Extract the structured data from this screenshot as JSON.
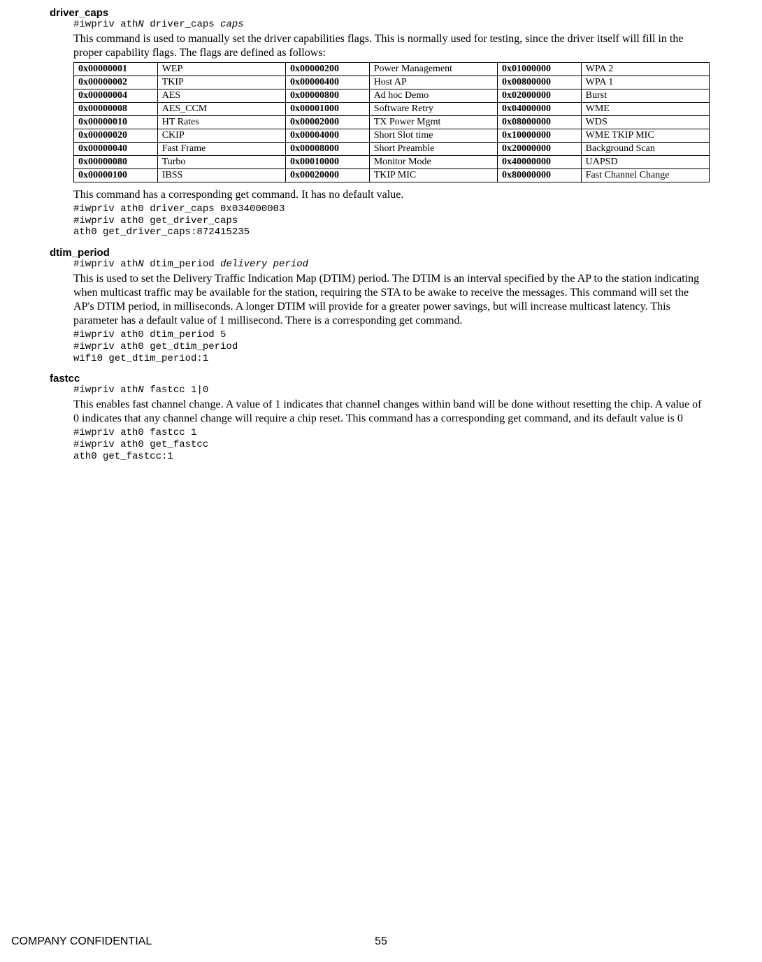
{
  "footer": {
    "label": "COMPANY CONFIDENTIAL",
    "page": "55"
  },
  "driver_caps": {
    "title": "driver_caps",
    "syntax_pre": "#iwpriv ath",
    "syntax_n": "N",
    "syntax_mid": " driver_caps ",
    "syntax_arg": "caps",
    "desc1": "This command is used to manually set the driver capabilities flags. This is normally used for testing, since the driver itself will fill in the proper capability flags. The flags are defined as follows:",
    "table": [
      [
        "0x00000001",
        "WEP",
        "0x00000200",
        "Power Management",
        "0x01000000",
        "WPA 2"
      ],
      [
        "0x00000002",
        "TKIP",
        "0x00000400",
        "Host AP",
        "0x00800000",
        "WPA 1"
      ],
      [
        "0x00000004",
        "AES",
        "0x00000800",
        "Ad hoc Demo",
        "0x02000000",
        "Burst"
      ],
      [
        "0x00000008",
        "AES_CCM",
        "0x00001000",
        "Software Retry",
        "0x04000000",
        "WME"
      ],
      [
        "0x00000010",
        "HT Rates",
        "0x00002000",
        "TX Power Mgmt",
        "0x08000000",
        "WDS"
      ],
      [
        "0x00000020",
        "CKIP",
        "0x00004000",
        "Short Slot time",
        "0x10000000",
        "WME TKIP MIC"
      ],
      [
        "0x00000040",
        "Fast Frame",
        "0x00008000",
        "Short Preamble",
        "0x20000000",
        "Background Scan"
      ],
      [
        "0x00000080",
        "Turbo",
        "0x00010000",
        "Monitor Mode",
        "0x40000000",
        "UAPSD"
      ],
      [
        "0x00000100",
        "IBSS",
        "0x00020000",
        "TKIP MIC",
        "0x80000000",
        "Fast Channel Change"
      ]
    ],
    "desc2": "This command has a corresponding get command. It has no default value.",
    "example": "#iwpriv ath0 driver_caps 0x034000003\n#iwpriv ath0 get_driver_caps\nath0 get_driver_caps:872415235"
  },
  "dtim_period": {
    "title": "dtim_period",
    "syntax_pre": "#iwpriv ath",
    "syntax_n": "N",
    "syntax_mid": " dtim_period ",
    "syntax_arg": "delivery period",
    "desc": "This is used to set the Delivery Traffic Indication Map (DTIM) period. The DTIM is an interval specified by the AP to the station indicating when multicast traffic may be available for the station, requiring the STA to be awake to receive the messages. This command will set the AP's DTIM period, in milliseconds. A longer DTIM will provide for a greater power savings, but will increase multicast latency. This parameter has a default value of 1 millisecond. There is a corresponding get command.",
    "example": "#iwpriv ath0 dtim_period 5\n#iwpriv ath0 get_dtim_period\nwifi0 get_dtim_period:1"
  },
  "fastcc": {
    "title": "fastcc",
    "syntax_pre": "#iwpriv ath",
    "syntax_n": "N",
    "syntax_mid": " fastcc 1|0",
    "desc": "This enables fast channel change. A value of 1 indicates that channel changes within band will be done without resetting the chip. A value of 0 indicates that any channel change will require a chip reset. This command has a corresponding get command, and its default value is 0",
    "example": "#iwpriv ath0 fastcc 1\n#iwpriv ath0 get_fastcc\nath0 get_fastcc:1"
  }
}
